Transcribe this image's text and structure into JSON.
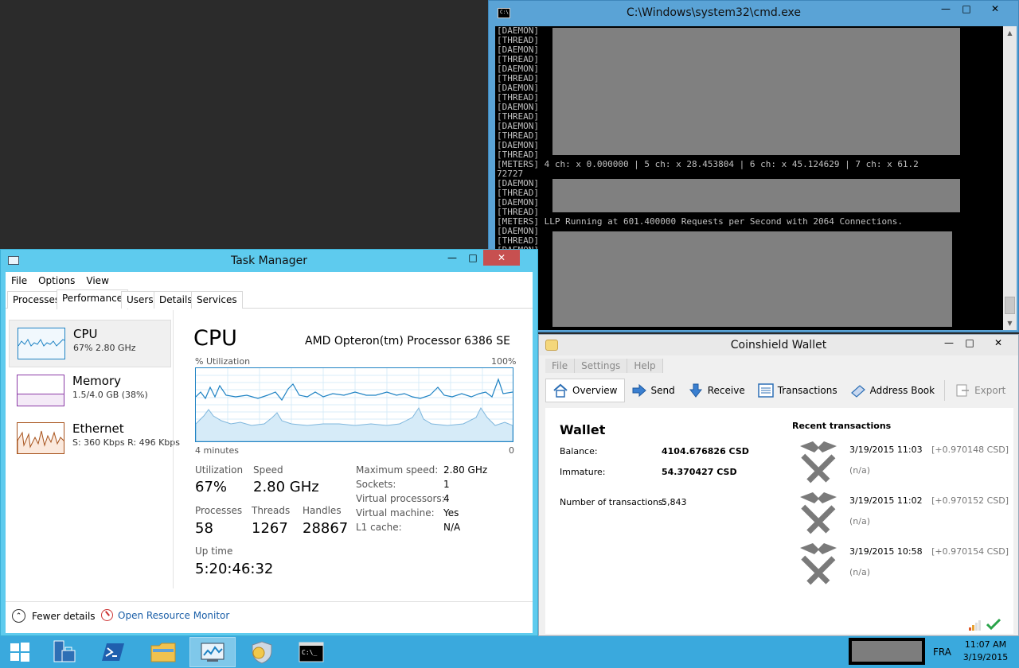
{
  "cmd": {
    "title": "C:\\Windows\\system32\\cmd.exe",
    "lines": [
      "[DAEMON]",
      "[THREAD]",
      "[DAEMON]",
      "[THREAD]",
      "[DAEMON]",
      "[THREAD]",
      "[DAEMON]",
      "[THREAD]",
      "[DAEMON]",
      "[THREAD]",
      "[DAEMON]",
      "[THREAD]",
      "[DAEMON]",
      "[THREAD]",
      "[METERS] 4 ch: x 0.000000 | 5 ch: x 28.453804 | 6 ch: x 45.124629 | 7 ch: x 61.2",
      "72727",
      "[DAEMON]",
      "[THREAD]",
      "[DAEMON]",
      "[THREAD]",
      "[METERS] LLP Running at 601.400000 Requests per Second with 2064 Connections.",
      "[DAEMON]",
      "[THREAD]",
      "[DAEMON]",
      "[THREAD]",
      "[DAEMON]",
      "[THREAD]",
      "[DAEMON]",
      "[THREAD]",
      "[DAEMON]"
    ]
  },
  "taskmgr": {
    "title": "Task Manager",
    "menu": [
      "File",
      "Options",
      "View"
    ],
    "tabs": [
      "Processes",
      "Performance",
      "Users",
      "Details",
      "Services"
    ],
    "side": {
      "cpu": {
        "name": "CPU",
        "sub": "67% 2.80 GHz"
      },
      "memory": {
        "name": "Memory",
        "sub": "1.5/4.0 GB (38%)"
      },
      "ethernet": {
        "name": "Ethernet",
        "sub": "S: 360 Kbps R: 496 Kbps"
      }
    },
    "heading": "CPU",
    "model": "AMD Opteron(tm) Processor 6386 SE",
    "graph_label": "% Utilization",
    "graph_max": "100%",
    "graph_time": "4 minutes",
    "graph_min": "0",
    "stats": {
      "utilization_label": "Utilization",
      "utilization": "67%",
      "speed_label": "Speed",
      "speed": "2.80 GHz",
      "processes_label": "Processes",
      "processes": "58",
      "threads_label": "Threads",
      "threads": "1267",
      "handles_label": "Handles",
      "handles": "28867",
      "uptime_label": "Up time",
      "uptime": "5:20:46:32"
    },
    "details": [
      {
        "k": "Maximum speed:",
        "v": "2.80 GHz"
      },
      {
        "k": "Sockets:",
        "v": "1"
      },
      {
        "k": "Virtual processors:",
        "v": "4"
      },
      {
        "k": "Virtual machine:",
        "v": "Yes"
      },
      {
        "k": "L1 cache:",
        "v": "N/A"
      }
    ],
    "fewer_details": "Fewer details",
    "open_resmon": "Open Resource Monitor"
  },
  "wallet": {
    "title": "Coinshield Wallet",
    "menu": [
      "File",
      "Settings",
      "Help"
    ],
    "toolbar": {
      "overview": "Overview",
      "send": "Send",
      "receive": "Receive",
      "transactions": "Transactions",
      "address_book": "Address Book",
      "export": "Export"
    },
    "heading": "Wallet",
    "balance_label": "Balance:",
    "balance": "4104.676826 CSD",
    "immature_label": "Immature:",
    "immature": "54.370427 CSD",
    "ntx_label": "Number of transactions:",
    "ntx": "5,843",
    "recent_heading": "Recent transactions",
    "recent": [
      {
        "date": "3/19/2015 11:03",
        "amount": "[+0.970148 CSD]",
        "label": "(n/a)"
      },
      {
        "date": "3/19/2015 11:02",
        "amount": "[+0.970152 CSD]",
        "label": "(n/a)"
      },
      {
        "date": "3/19/2015 10:58",
        "amount": "[+0.970154 CSD]",
        "label": "(n/a)"
      }
    ]
  },
  "taskbar": {
    "language": "FRA",
    "time": "11:07 AM",
    "date": "3/19/2015"
  },
  "colors": {
    "cmd_frame": "#5aa3d6",
    "tm_frame": "#5ecbee",
    "taskbar": "#3aa9dd",
    "graph_line": "#1f83c4",
    "close_red": "#c75050"
  }
}
